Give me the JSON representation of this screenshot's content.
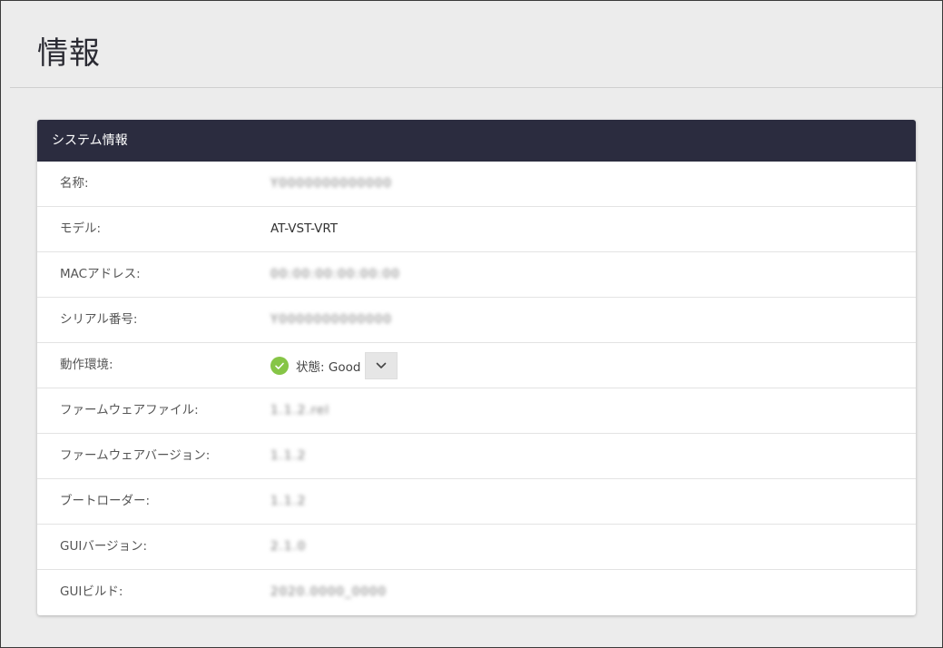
{
  "page": {
    "title": "情報"
  },
  "panel": {
    "header": "システム情報",
    "rows": [
      {
        "label": "名称:",
        "value": "Y0000000000000"
      },
      {
        "label": "モデル:",
        "value": "AT-VST-VRT"
      },
      {
        "label": "MACアドレス:",
        "value": "00:00:00:00:00:00"
      },
      {
        "label": "シリアル番号:",
        "value": "Y0000000000000"
      },
      {
        "label": "動作環境:",
        "status_prefix": "状態:",
        "status": "Good"
      },
      {
        "label": "ファームウェアファイル:",
        "value": "1.1.2.rel"
      },
      {
        "label": "ファームウェアバージョン:",
        "value": "1.1.2"
      },
      {
        "label": "ブートローダー:",
        "value": "1.1.2"
      },
      {
        "label": "GUIバージョン:",
        "value": "2.1.0"
      },
      {
        "label": "GUIビルド:",
        "value": "2020.0000_0000"
      }
    ]
  },
  "colors": {
    "header_bg": "#2b2c3f",
    "status_good": "#86c546",
    "page_bg": "#ececec"
  },
  "icons": {
    "status": "check-circle-icon",
    "dropdown": "chevron-down-icon"
  }
}
